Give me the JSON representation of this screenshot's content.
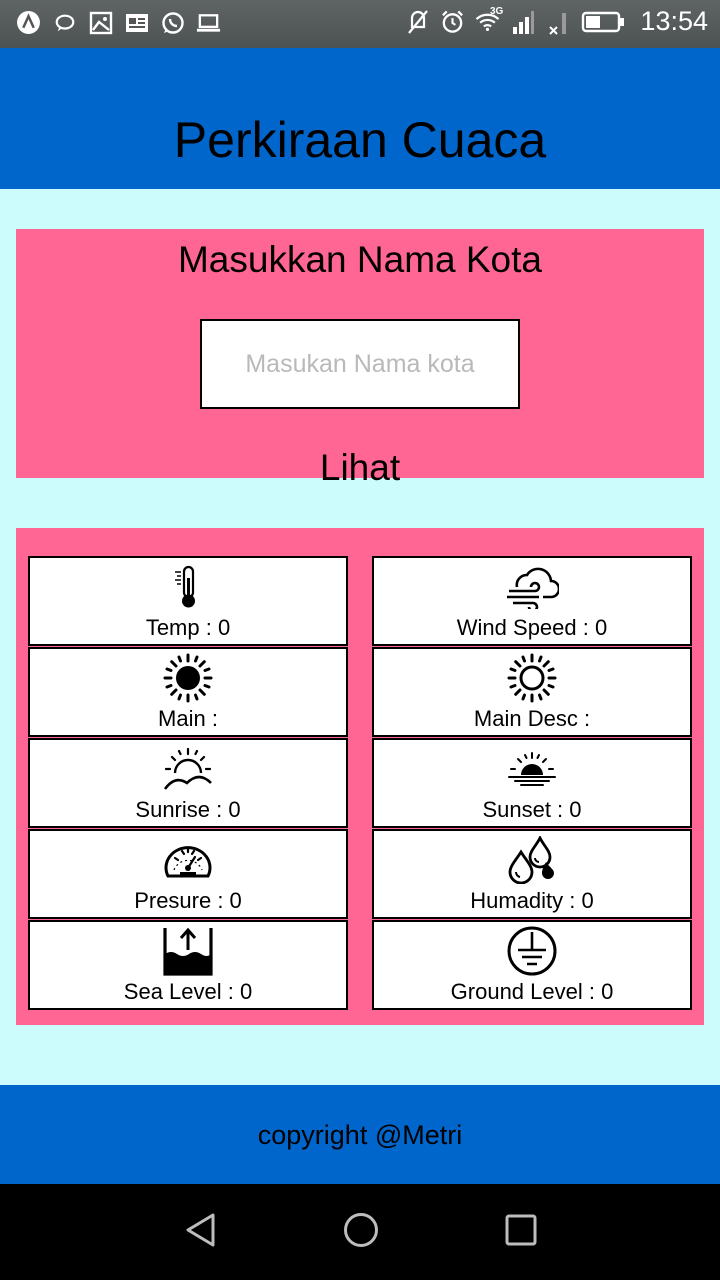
{
  "status_bar": {
    "time": "13:54",
    "network_label": "3G",
    "left_icons": [
      "android-icon",
      "chat-bubble-icon",
      "image-icon",
      "news-icon",
      "whatsapp-icon",
      "laptop-icon"
    ],
    "right_icons": [
      "mute-icon",
      "alarm-icon",
      "wifi-icon",
      "signal-icon",
      "signal-x-icon",
      "battery-icon"
    ]
  },
  "header": {
    "title": "Perkiraan Cuaca"
  },
  "search": {
    "heading": "Masukkan Nama Kota",
    "input_value": "",
    "input_placeholder": "Masukan Nama kota",
    "button_label": "Lihat"
  },
  "weather": {
    "items": [
      {
        "label": "Temp : 0",
        "icon": "thermometer-icon"
      },
      {
        "label": "Wind Speed : 0",
        "icon": "wind-cloud-icon"
      },
      {
        "label": "Main :",
        "icon": "sun-filled-icon"
      },
      {
        "label": "Main Desc :",
        "icon": "sun-outline-icon"
      },
      {
        "label": "Sunrise : 0",
        "icon": "sunrise-icon"
      },
      {
        "label": "Sunset : 0",
        "icon": "sunset-icon"
      },
      {
        "label": "Presure : 0",
        "icon": "pressure-gauge-icon"
      },
      {
        "label": "Humadity : 0",
        "icon": "humidity-drops-icon"
      },
      {
        "label": "Sea Level : 0",
        "icon": "sea-level-icon"
      },
      {
        "label": "Ground Level : 0",
        "icon": "ground-level-icon"
      }
    ]
  },
  "footer": {
    "text": "copyright @Metri"
  },
  "nav": {
    "icons": [
      "back-icon",
      "home-icon",
      "recents-icon"
    ]
  },
  "colors": {
    "header_blue": "#0066cc",
    "panel_pink": "#ff6693",
    "background_cyan": "#ccfcfc",
    "status_bar": "#5f6465",
    "nav_bar": "#000000"
  }
}
